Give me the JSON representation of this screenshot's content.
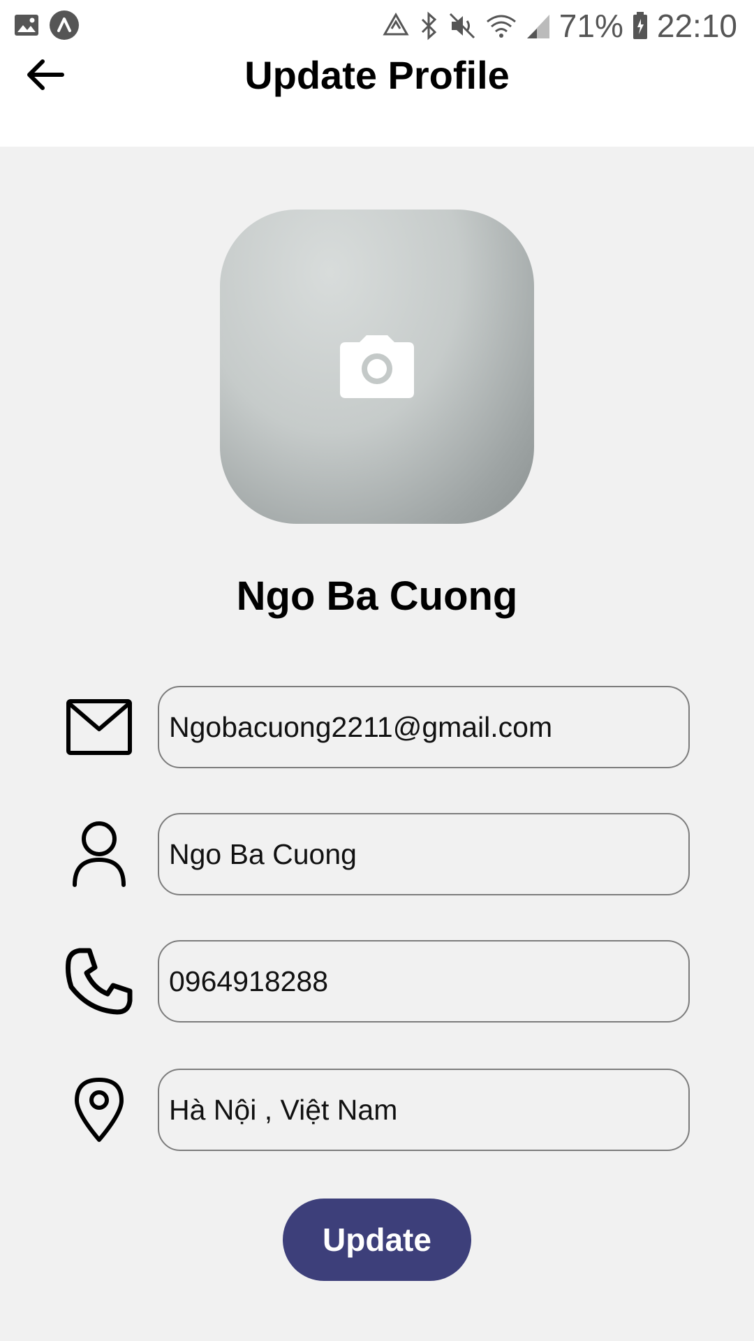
{
  "status_bar": {
    "battery": "71%",
    "time": "22:10"
  },
  "header": {
    "title": "Update Profile",
    "back_icon": "arrow-left-icon"
  },
  "profile": {
    "name": "Ngo Ba Cuong",
    "avatar_icon": "camera-icon"
  },
  "form": {
    "email": {
      "icon": "mail-icon",
      "value": "Ngobacuong2211@gmail.com"
    },
    "name": {
      "icon": "user-icon",
      "value": "Ngo Ba Cuong"
    },
    "phone": {
      "icon": "phone-icon",
      "value": "0964918288"
    },
    "address": {
      "icon": "location-pin-icon",
      "value": "Hà Nội , Việt Nam"
    }
  },
  "actions": {
    "update_label": "Update"
  },
  "colors": {
    "button": "#3d3f7a",
    "background": "#f1f1f1",
    "header": "#ffffff"
  }
}
